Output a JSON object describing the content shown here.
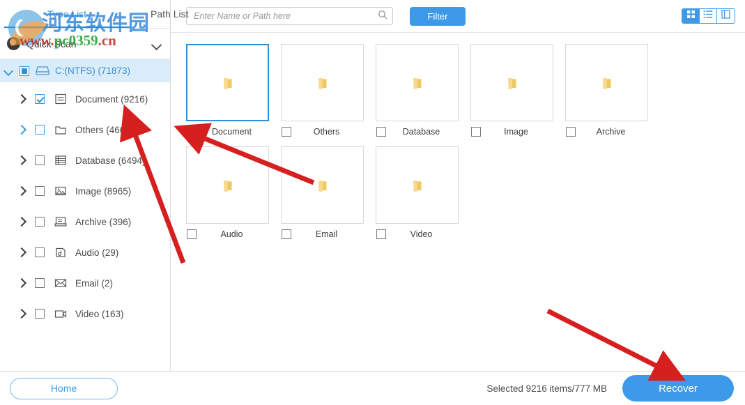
{
  "sidebar": {
    "tabs": [
      {
        "label": "Type List",
        "active": true
      },
      {
        "label": "Path List",
        "active": false
      }
    ],
    "scan": {
      "label": "Quick Scan",
      "icon": "scan-mode-icon",
      "chevron": "chevron-down-icon"
    },
    "drive": {
      "label": "C:(NTFS) (71873)",
      "icon": "hard-drive-icon",
      "checkbox_state": "partial",
      "expanded": true
    },
    "items": [
      {
        "label": "Document (9216)",
        "icon": "document-icon",
        "checked": true,
        "highlighted": false
      },
      {
        "label": "Others (46608)",
        "icon": "folder-icon",
        "checked": false,
        "highlighted": true
      },
      {
        "label": "Database (6494)",
        "icon": "database-icon",
        "checked": false,
        "highlighted": false
      },
      {
        "label": "Image (8965)",
        "icon": "image-icon",
        "checked": false,
        "highlighted": false
      },
      {
        "label": "Archive (396)",
        "icon": "archive-icon",
        "checked": false,
        "highlighted": false
      },
      {
        "label": "Audio (29)",
        "icon": "audio-icon",
        "checked": false,
        "highlighted": false
      },
      {
        "label": "Email (2)",
        "icon": "email-icon",
        "checked": false,
        "highlighted": false
      },
      {
        "label": "Video (163)",
        "icon": "video-icon",
        "checked": false,
        "highlighted": false
      }
    ]
  },
  "toolbar": {
    "search": {
      "value": "",
      "placeholder": "Enter Name or Path here",
      "icon": "search-icon"
    },
    "filter_label": "Filter",
    "views": [
      {
        "name": "grid-view",
        "icon": "grid-icon",
        "active": true
      },
      {
        "name": "list-view",
        "icon": "list-icon",
        "active": false
      },
      {
        "name": "split-view",
        "icon": "split-pane-icon",
        "active": false
      }
    ]
  },
  "main": {
    "cards": [
      {
        "label": "Document",
        "checked": true,
        "selected": true,
        "icon": "folder-icon"
      },
      {
        "label": "Others",
        "checked": false,
        "selected": false,
        "icon": "folder-icon"
      },
      {
        "label": "Database",
        "checked": false,
        "selected": false,
        "icon": "folder-icon"
      },
      {
        "label": "Image",
        "checked": false,
        "selected": false,
        "icon": "folder-icon"
      },
      {
        "label": "Archive",
        "checked": false,
        "selected": false,
        "icon": "folder-icon"
      },
      {
        "label": "Audio",
        "checked": false,
        "selected": false,
        "icon": "folder-icon"
      },
      {
        "label": "Email",
        "checked": false,
        "selected": false,
        "icon": "folder-icon"
      },
      {
        "label": "Video",
        "checked": false,
        "selected": false,
        "icon": "folder-icon"
      }
    ]
  },
  "footer": {
    "home_label": "Home",
    "selection_text": "Selected 9216 items/777 MB",
    "recover_label": "Recover"
  },
  "watermark": {
    "site_cn": "河东软件园",
    "url_red": "www.",
    "url_green": "pc0359",
    "url_red2": ".cn"
  },
  "colors": {
    "accent": "#3d9ae8",
    "accent_dark": "#2f8fd8",
    "selected_row": "#d9ecfa",
    "folder": "#f2d27e",
    "arrow": "#d62020"
  }
}
